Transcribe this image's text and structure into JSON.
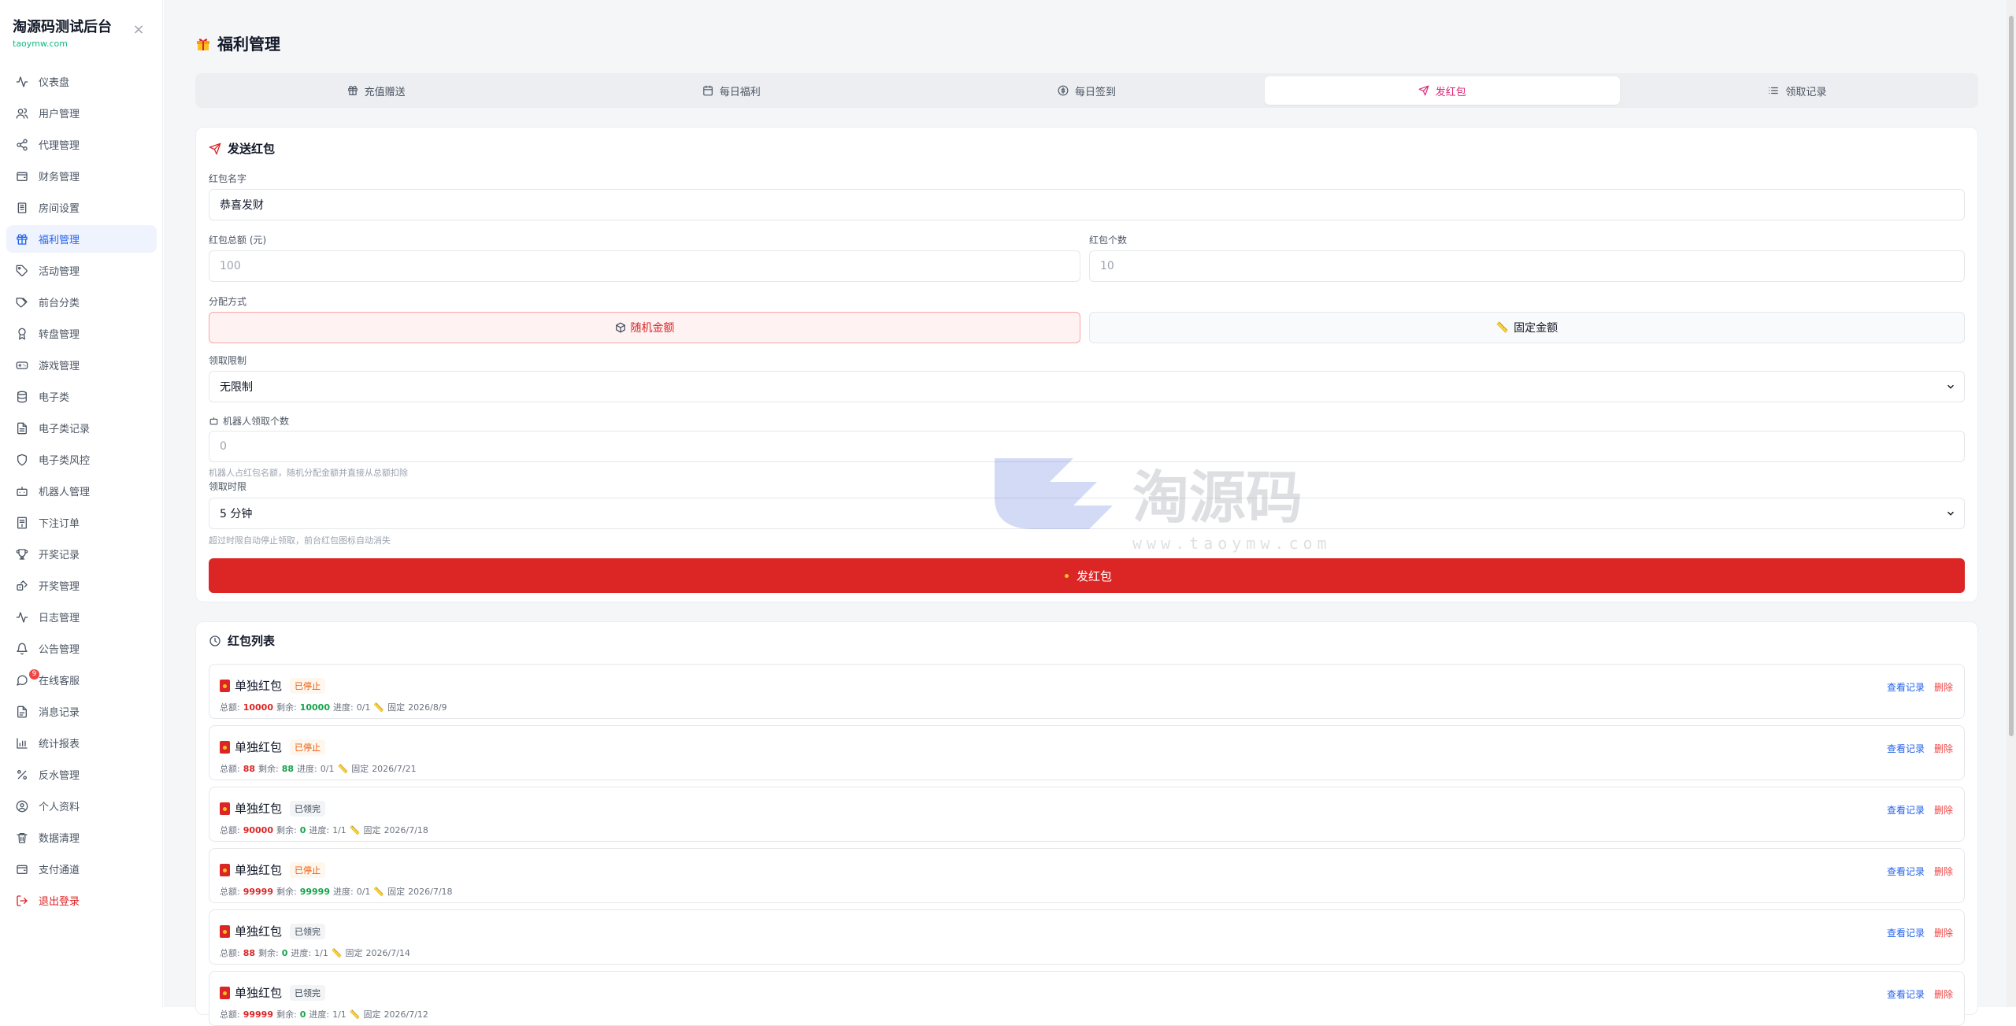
{
  "app": {
    "title": "淘源码测试后台",
    "subtitle": "taoymw.com"
  },
  "sidebar": {
    "items": [
      {
        "label": "仪表盘",
        "icon": "activity-icon"
      },
      {
        "label": "用户管理",
        "icon": "users-icon"
      },
      {
        "label": "代理管理",
        "icon": "share-icon"
      },
      {
        "label": "财务管理",
        "icon": "wallet-icon"
      },
      {
        "label": "房间设置",
        "icon": "building-icon"
      },
      {
        "label": "福利管理",
        "icon": "gift-icon",
        "active": true
      },
      {
        "label": "活动管理",
        "icon": "tag-icon"
      },
      {
        "label": "前台分类",
        "icon": "tags-icon"
      },
      {
        "label": "转盘管理",
        "icon": "award-icon"
      },
      {
        "label": "游戏管理",
        "icon": "gamepad-icon"
      },
      {
        "label": "电子类",
        "icon": "database-icon"
      },
      {
        "label": "电子类记录",
        "icon": "file-text-icon"
      },
      {
        "label": "电子类风控",
        "icon": "shield-icon"
      },
      {
        "label": "机器人管理",
        "icon": "bot-icon"
      },
      {
        "label": "下注订单",
        "icon": "receipt-icon"
      },
      {
        "label": "开奖记录",
        "icon": "trophy-icon"
      },
      {
        "label": "开奖管理",
        "icon": "dice-icon"
      },
      {
        "label": "日志管理",
        "icon": "pulse-icon"
      },
      {
        "label": "公告管理",
        "icon": "bell-icon"
      },
      {
        "label": "在线客服",
        "icon": "message-icon",
        "badge": "9"
      },
      {
        "label": "消息记录",
        "icon": "file-icon"
      },
      {
        "label": "统计报表",
        "icon": "bar-chart-icon"
      },
      {
        "label": "反水管理",
        "icon": "percent-icon"
      },
      {
        "label": "个人资料",
        "icon": "user-circle-icon"
      },
      {
        "label": "数据清理",
        "icon": "trash-icon"
      },
      {
        "label": "支付通道",
        "icon": "wallet-icon"
      },
      {
        "label": "退出登录",
        "icon": "logout-icon",
        "danger": true
      }
    ]
  },
  "header": {
    "title": "福利管理"
  },
  "tabs": [
    {
      "label": "充值赠送",
      "icon": "gift-icon"
    },
    {
      "label": "每日福利",
      "icon": "calendar-icon"
    },
    {
      "label": "每日签到",
      "icon": "coin-icon"
    },
    {
      "label": "发红包",
      "icon": "send-icon",
      "active": true
    },
    {
      "label": "领取记录",
      "icon": "list-icon"
    }
  ],
  "form": {
    "title": "发送红包",
    "name_label": "红包名字",
    "name_value": "恭喜发财",
    "amount_label": "红包总额 (元)",
    "amount_placeholder": "100",
    "count_label": "红包个数",
    "count_placeholder": "10",
    "dist_label": "分配方式",
    "dist_random": "随机金额",
    "dist_fixed": "固定金额",
    "limit_label": "领取限制",
    "limit_value": "无限制",
    "robot_label": "机器人领取个数",
    "robot_placeholder": "0",
    "robot_hint": "机器人占红包名额，随机分配金额并直接从总额扣除",
    "time_label": "领取时限",
    "time_value": "5 分钟",
    "time_hint": "超过时限自动停止领取，前台红包图标自动消失",
    "submit": "发红包"
  },
  "list": {
    "title": "红包列表",
    "total_label": "总额:",
    "remain_label": "剩余:",
    "progress_label": "进度:",
    "view_label": "查看记录",
    "delete_label": "删除",
    "items": [
      {
        "name": "单独红包",
        "status": "已停止",
        "status_type": "stopped",
        "total": "10000",
        "remain": "10000",
        "progress": "0/1",
        "mode": "固定",
        "date": "2026/8/9"
      },
      {
        "name": "单独红包",
        "status": "已停止",
        "status_type": "stopped",
        "total": "88",
        "remain": "88",
        "progress": "0/1",
        "mode": "固定",
        "date": "2026/7/21"
      },
      {
        "name": "单独红包",
        "status": "已领完",
        "status_type": "done",
        "total": "90000",
        "remain": "0",
        "progress": "1/1",
        "mode": "固定",
        "date": "2026/7/18"
      },
      {
        "name": "单独红包",
        "status": "已停止",
        "status_type": "stopped",
        "total": "99999",
        "remain": "99999",
        "progress": "0/1",
        "mode": "固定",
        "date": "2026/7/18"
      },
      {
        "name": "单独红包",
        "status": "已领完",
        "status_type": "done",
        "total": "88",
        "remain": "0",
        "progress": "1/1",
        "mode": "固定",
        "date": "2026/7/14"
      },
      {
        "name": "单独红包",
        "status": "已领完",
        "status_type": "done",
        "total": "99999",
        "remain": "0",
        "progress": "1/1",
        "mode": "固定",
        "date": "2026/7/12"
      }
    ]
  },
  "watermark": {
    "text": "淘源码",
    "url": "www.taoymw.com"
  },
  "colors": {
    "accent": "#2563eb",
    "danger": "#dc2626",
    "tab_active": "#db2777",
    "success": "#16a34a",
    "warning": "#ea580c"
  }
}
